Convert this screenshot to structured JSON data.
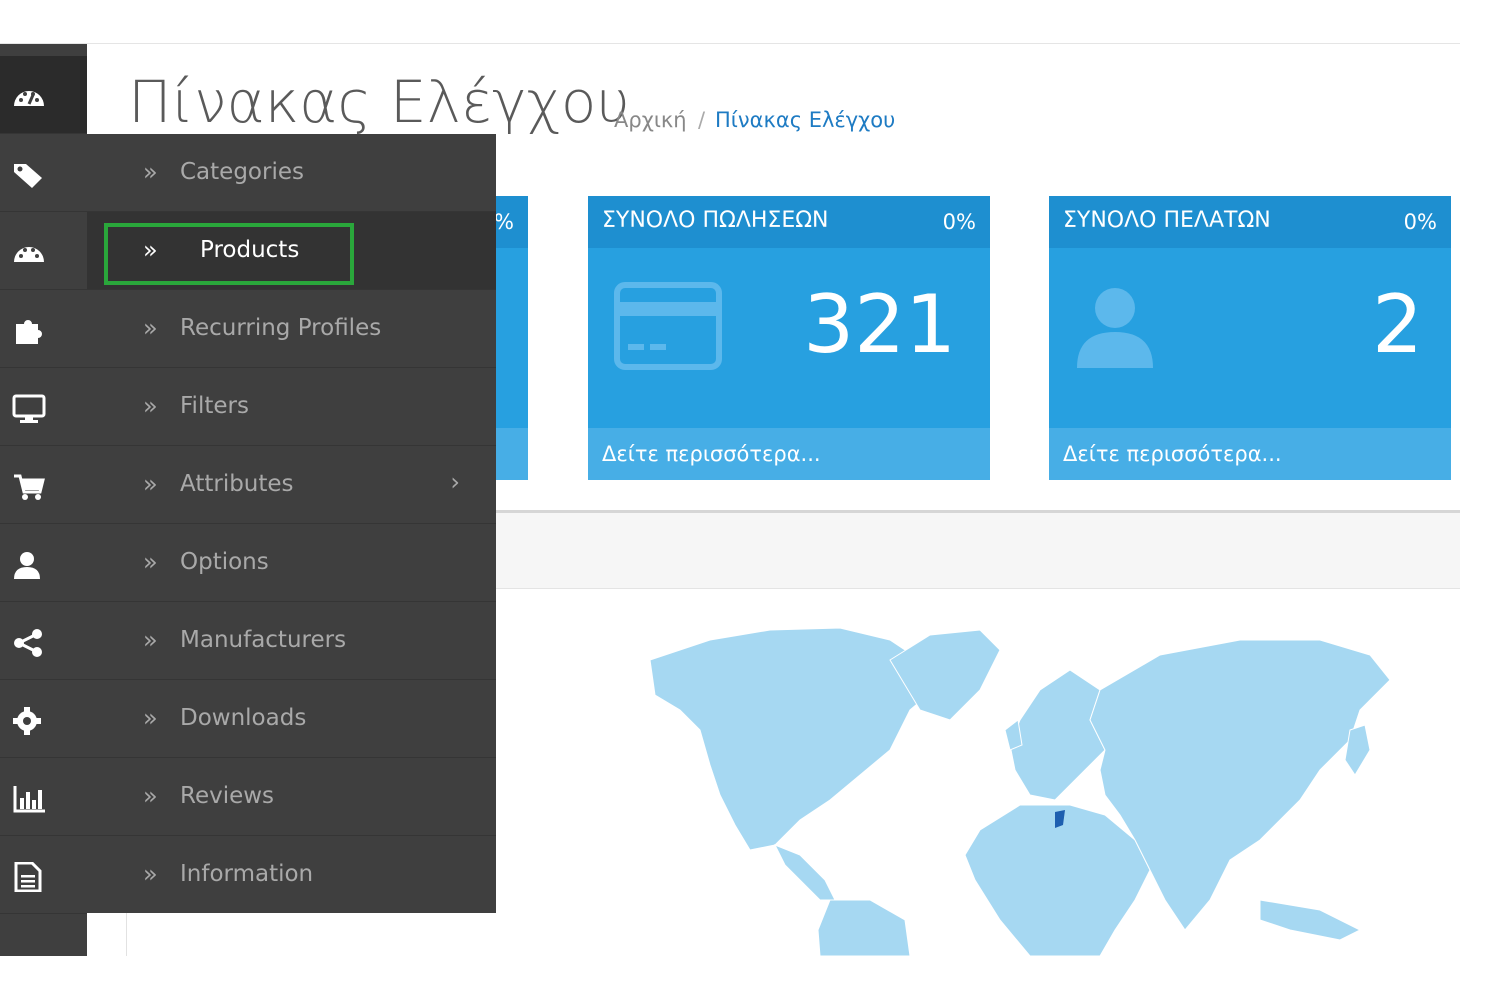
{
  "header": {
    "title": "Πίνακας Ελέγχου",
    "breadcrumb": {
      "home": "Αρχική",
      "separator": "/",
      "current": "Πίνακας Ελέγχου"
    }
  },
  "iconbar": {
    "items": [
      {
        "icon": "dashboard-icon",
        "active": true
      },
      {
        "icon": "tags-icon"
      },
      {
        "icon": "palette-icon"
      },
      {
        "icon": "puzzle-icon"
      },
      {
        "icon": "monitor-icon"
      },
      {
        "icon": "cart-icon"
      },
      {
        "icon": "user-icon"
      },
      {
        "icon": "share-icon"
      },
      {
        "icon": "gear-icon"
      },
      {
        "icon": "bar-chart-icon"
      },
      {
        "icon": "document-icon"
      }
    ]
  },
  "flyout": {
    "items": [
      {
        "label": "Categories"
      },
      {
        "label": "Products",
        "selected": true
      },
      {
        "label": "Recurring Profiles"
      },
      {
        "label": "Filters"
      },
      {
        "label": "Attributes",
        "has_submenu": true
      },
      {
        "label": "Options"
      },
      {
        "label": "Manufacturers"
      },
      {
        "label": "Downloads"
      },
      {
        "label": "Reviews"
      },
      {
        "label": "Information"
      }
    ],
    "chevron": "»",
    "submenu_caret": "›"
  },
  "tiles": {
    "partial": {
      "percent": "%"
    },
    "sales": {
      "title": "ΣΥΝΟΛΟ ΠΩΛΗΣΕΩΝ",
      "percent": "0%",
      "value": "321",
      "footer": "Δείτε περισσότερα..."
    },
    "customers": {
      "title": "ΣΥΝΟΛΟ ΠΕΛΑΤΩΝ",
      "percent": "0%",
      "value": "2",
      "footer": "Δείτε περισσότερα..."
    }
  },
  "colors": {
    "tile": "#27a0e0",
    "tile_head": "#1e8fd0",
    "sidebar": "#3f3f3f",
    "highlight": "#2aa73b",
    "map_land": "#a6d8f2",
    "map_selected": "#1e5fb0"
  }
}
